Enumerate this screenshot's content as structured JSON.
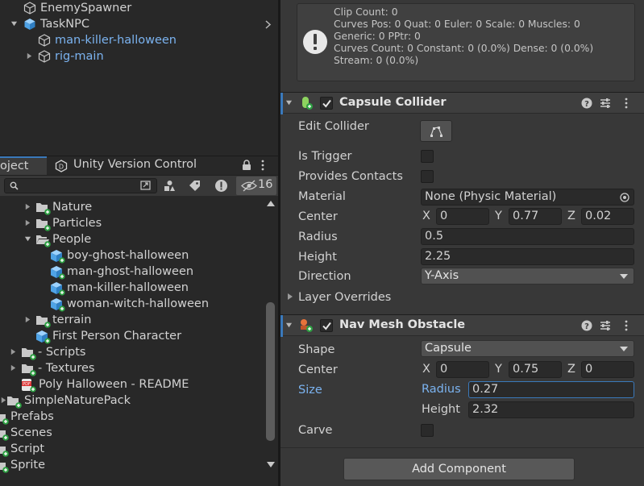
{
  "hierarchy": {
    "items": [
      {
        "label": "EnemySpawner"
      },
      {
        "label": "TaskNPC"
      },
      {
        "label": "man-killer-halloween"
      },
      {
        "label": "rig-main"
      }
    ]
  },
  "project_panel": {
    "tabs": [
      {
        "label": "oject"
      },
      {
        "label": "Unity Version Control"
      }
    ],
    "search_placeholder": "",
    "hidden_count": "16",
    "items": [
      {
        "label": "Nature"
      },
      {
        "label": "Particles"
      },
      {
        "label": "People"
      },
      {
        "label": "boy-ghost-halloween"
      },
      {
        "label": "man-ghost-halloween"
      },
      {
        "label": "man-killer-halloween"
      },
      {
        "label": "woman-witch-halloween"
      },
      {
        "label": "terrain"
      },
      {
        "label": "First Person Character"
      },
      {
        "label": "- Scripts"
      },
      {
        "label": "- Textures"
      },
      {
        "label": "Poly Halloween - README"
      },
      {
        "label": "SimpleNaturePack"
      },
      {
        "label": "Prefabs"
      },
      {
        "label": "Scenes"
      },
      {
        "label": "Script"
      },
      {
        "label": "Sprite"
      }
    ]
  },
  "inspector": {
    "animator_info": {
      "lines": [
        "Clip Count: 0",
        "Curves Pos: 0 Quat: 0 Euler: 0 Scale: 0 Muscles: 0",
        "Generic: 0 PPtr: 0",
        "Curves Count: 0 Constant: 0 (0.0%) Dense: 0 (0.0%)",
        "Stream: 0 (0.0%)"
      ]
    },
    "capsule_collider": {
      "title": "Capsule Collider",
      "edit_collider_label": "Edit Collider",
      "is_trigger_label": "Is Trigger",
      "provides_contacts_label": "Provides Contacts",
      "material_label": "Material",
      "material_value": "None (Physic Material)",
      "center_label": "Center",
      "center": {
        "x_label": "X",
        "x": "0",
        "y_label": "Y",
        "y": "0.77",
        "z_label": "Z",
        "z": "0.02"
      },
      "radius_label": "Radius",
      "radius": "0.5",
      "height_label": "Height",
      "height": "2.25",
      "direction_label": "Direction",
      "direction": "Y-Axis",
      "layer_overrides_label": "Layer Overrides"
    },
    "nav_mesh_obstacle": {
      "title": "Nav Mesh Obstacle",
      "shape_label": "Shape",
      "shape": "Capsule",
      "center_label": "Center",
      "center": {
        "x_label": "X",
        "x": "0",
        "y_label": "Y",
        "y": "0.75",
        "z_label": "Z",
        "z": "0"
      },
      "size_label": "Size",
      "radius_label": "Radius",
      "radius": "0.27",
      "height_label": "Height",
      "height": "2.32",
      "carve_label": "Carve"
    },
    "add_component_label": "Add Component"
  },
  "colors": {
    "accent_blue": "#3a79bb",
    "prefab_blue": "#7bb3f0",
    "panel_bg": "#383838",
    "dark_bg": "#282828"
  }
}
